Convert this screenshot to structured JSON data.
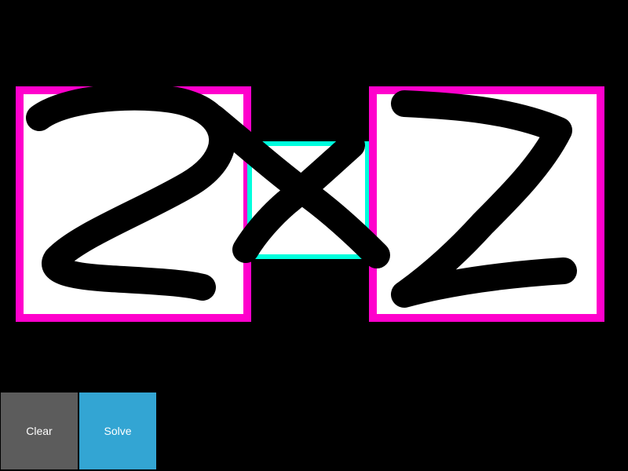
{
  "toolbar": {
    "clear_label": "Clear",
    "solve_label": "Solve"
  },
  "recognized_symbols": [
    {
      "label": "2",
      "box_color": "#ff00cc"
    },
    {
      "label": "×",
      "box_color": "#00ffdd"
    },
    {
      "label": "2",
      "box_color": "#ff00cc"
    }
  ],
  "colors": {
    "background": "#000000",
    "ink": "#000000",
    "paper": "#ffffff",
    "digit_box": "#ff00cc",
    "operator_box": "#00ffdd",
    "clear_button": "#5c5c5c",
    "solve_button": "#33a5d3",
    "button_text": "#ffffff"
  }
}
